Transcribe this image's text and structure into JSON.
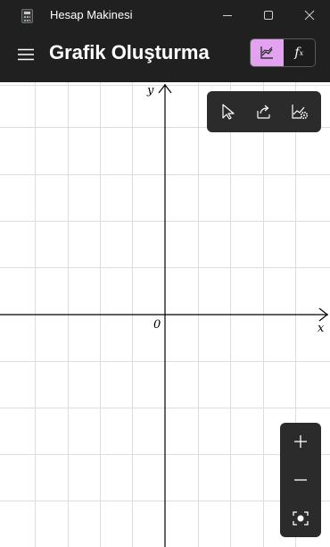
{
  "window": {
    "title": "Hesap Makinesi",
    "icons": {
      "app": "calculator-icon",
      "minimize": "minimize-icon",
      "maximize": "maximize-icon",
      "close": "close-icon"
    }
  },
  "header": {
    "title": "Grafik Oluşturma",
    "menu_icon": "hamburger-menu-icon",
    "mode_toggle": {
      "graph_icon": "graph-icon",
      "function_label": "f",
      "function_subscript": "x",
      "selected": "graph"
    }
  },
  "graph": {
    "x_axis_label": "x",
    "y_axis_label": "y",
    "origin_label": "0",
    "toolbar": {
      "select_icon": "pointer-icon",
      "share_icon": "share-icon",
      "settings_icon": "graph-settings-icon"
    },
    "zoom": {
      "zoom_in_label": "+",
      "zoom_out_label": "−",
      "reset_icon": "fit-view-icon"
    }
  },
  "colors": {
    "titlebar_bg": "#202020",
    "accent": "#e2a2ef",
    "graph_bg": "#ffffff",
    "grid_line": "#dcdcdc",
    "axis": "#000000",
    "panel_bg": "#2b2b2b"
  }
}
